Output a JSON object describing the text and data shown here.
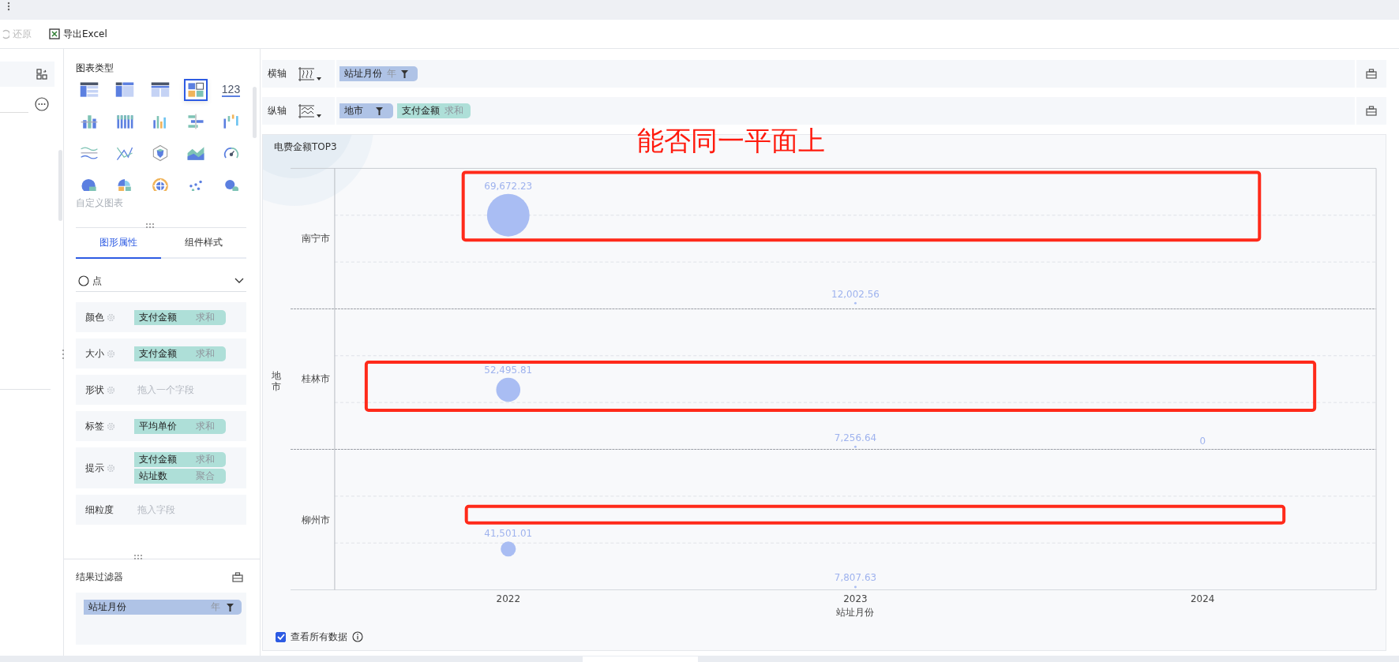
{
  "toolbar": {
    "buttons": [
      {
        "kind": "restore",
        "label": "还原",
        "disabled": true
      },
      {
        "kind": "excel",
        "label": "导出Excel",
        "disabled": false
      }
    ]
  },
  "chart_types": {
    "title": "图表类型",
    "items": [
      {
        "kind": "detail",
        "selected": false
      },
      {
        "kind": "group",
        "selected": false
      },
      {
        "kind": "cross",
        "selected": false
      },
      {
        "kind": "multi",
        "selected": true
      },
      {
        "kind": "kpi",
        "label": "123",
        "selected": false
      },
      {
        "kind": "stacked",
        "selected": false
      },
      {
        "kind": "grouped",
        "selected": false
      },
      {
        "kind": "bars",
        "selected": false
      },
      {
        "kind": "ranged",
        "selected": false
      },
      {
        "kind": "waterfall",
        "selected": false
      },
      {
        "kind": "flow",
        "selected": false
      },
      {
        "kind": "line",
        "selected": false
      },
      {
        "kind": "radar",
        "selected": false
      },
      {
        "kind": "area",
        "selected": false
      },
      {
        "kind": "gauge",
        "selected": false
      },
      {
        "kind": "pie",
        "selected": false
      },
      {
        "kind": "rose",
        "selected": false
      },
      {
        "kind": "sunburst",
        "selected": false
      },
      {
        "kind": "scatter",
        "selected": false
      },
      {
        "kind": "bubble",
        "selected": false
      }
    ],
    "custom_label": "自定义图表"
  },
  "tabs": [
    {
      "label": "图形属性",
      "selected": true
    },
    {
      "label": "组件样式",
      "selected": false
    }
  ],
  "mark_type": {
    "label": "点"
  },
  "properties": [
    {
      "label": "颜色",
      "settings": true,
      "fields": [
        {
          "name": "支付金额",
          "agg": "求和",
          "kind": "measure"
        }
      ]
    },
    {
      "label": "大小",
      "settings": true,
      "fields": [
        {
          "name": "支付金额",
          "agg": "求和",
          "kind": "measure"
        }
      ]
    },
    {
      "label": "形状",
      "settings": true,
      "placeholder": "拖入一个字段"
    },
    {
      "label": "标签",
      "settings": true,
      "fields": [
        {
          "name": "平均单价",
          "agg": "求和",
          "kind": "measure"
        }
      ]
    },
    {
      "label": "提示",
      "settings": true,
      "fields": [
        {
          "name": "支付金额",
          "agg": "求和",
          "kind": "measure"
        },
        {
          "name": "站址数",
          "agg": "聚合",
          "kind": "measure"
        }
      ]
    },
    {
      "label": "细粒度",
      "settings": false,
      "placeholder": "拖入字段"
    }
  ],
  "result_filter": {
    "title": "结果过滤器",
    "fields": [
      {
        "name": "站址月份",
        "agg": "年",
        "filter": true,
        "kind": "dimension"
      }
    ]
  },
  "axes": [
    {
      "label": "横轴",
      "kind": "horizontal",
      "fields": [
        {
          "name": "站址月份",
          "agg": "年",
          "filter": true,
          "kind": "dimension"
        }
      ]
    },
    {
      "label": "纵轴",
      "kind": "vertical",
      "fields": [
        {
          "name": "地市",
          "filter": true,
          "kind": "dimension"
        },
        {
          "name": "支付金额",
          "agg": "求和",
          "kind": "measure"
        }
      ]
    }
  ],
  "chart": {
    "title": "电费金额TOP3",
    "x_title": "站址月份",
    "y_title": "地市",
    "x_categories": [
      "2022",
      "2023",
      "2024"
    ],
    "rows": [
      {
        "name": "南宁市",
        "points": [
          {
            "label": "69,672.23"
          },
          {
            "label": "12,002.56"
          }
        ]
      },
      {
        "name": "桂林市",
        "points": [
          {
            "label": "52,495.81"
          },
          {
            "label": "7,256.64"
          },
          {
            "label": "0"
          }
        ]
      },
      {
        "name": "柳州市",
        "points": [
          {
            "label": "41,501.01"
          },
          {
            "label": "7,807.63"
          }
        ]
      }
    ],
    "show_all": {
      "label": "查看所有数据",
      "checked": true
    }
  },
  "annotation": {
    "text": "能否同一平面上"
  }
}
